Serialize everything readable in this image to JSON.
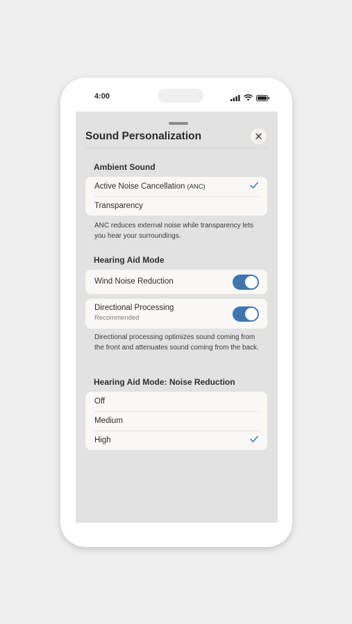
{
  "status_bar": {
    "time": "4:00",
    "icons": [
      "cellular-signal-icon",
      "wifi-icon",
      "battery-icon"
    ]
  },
  "sheet": {
    "title": "Sound Personalization",
    "close_icon": "close-icon"
  },
  "ambient_sound": {
    "title": "Ambient Sound",
    "options": [
      {
        "label": "Active Noise Cancellation",
        "suffix": "(ANC)",
        "selected": true
      },
      {
        "label": "Transparency",
        "selected": false
      }
    ],
    "help": "ANC reduces external noise while transparency lets you hear your surroundings."
  },
  "hearing_aid_mode": {
    "title": "Hearing Aid Mode",
    "toggles": [
      {
        "label": "Wind Noise Reduction",
        "on": true
      },
      {
        "label": "Directional Processing",
        "sublabel": "Recommended",
        "on": true
      }
    ],
    "help": "Directional processing optimizes sound coming from the front and attenuates sound coming from the back."
  },
  "noise_reduction": {
    "title": "Hearing Aid Mode: Noise Reduction",
    "options": [
      {
        "label": "Off",
        "selected": false
      },
      {
        "label": "Medium",
        "selected": false
      },
      {
        "label": "High",
        "selected": true
      }
    ]
  },
  "colors": {
    "accent": "#3e76b0",
    "sheet_background": "#e2e2e2",
    "card_background": "#faf8f4",
    "page_background": "#efefef"
  }
}
